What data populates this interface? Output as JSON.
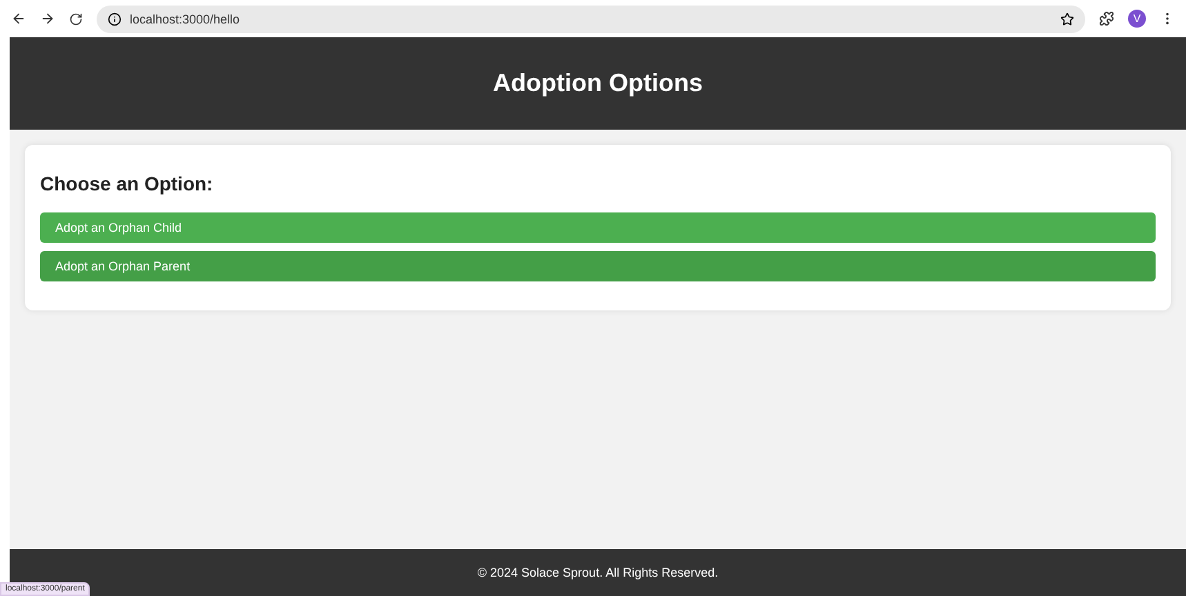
{
  "browser": {
    "url": "localhost:3000/hello",
    "avatar": "V",
    "status_url": "localhost:3000/parent"
  },
  "header": {
    "title": "Adoption Options"
  },
  "card": {
    "heading": "Choose an Option:",
    "options": [
      {
        "label": "Adopt an Orphan Child",
        "hovered": false
      },
      {
        "label": "Adopt an Orphan Parent",
        "hovered": true
      }
    ]
  },
  "footer": {
    "text": "© 2024 Solace Sprout. All Rights Reserved."
  }
}
